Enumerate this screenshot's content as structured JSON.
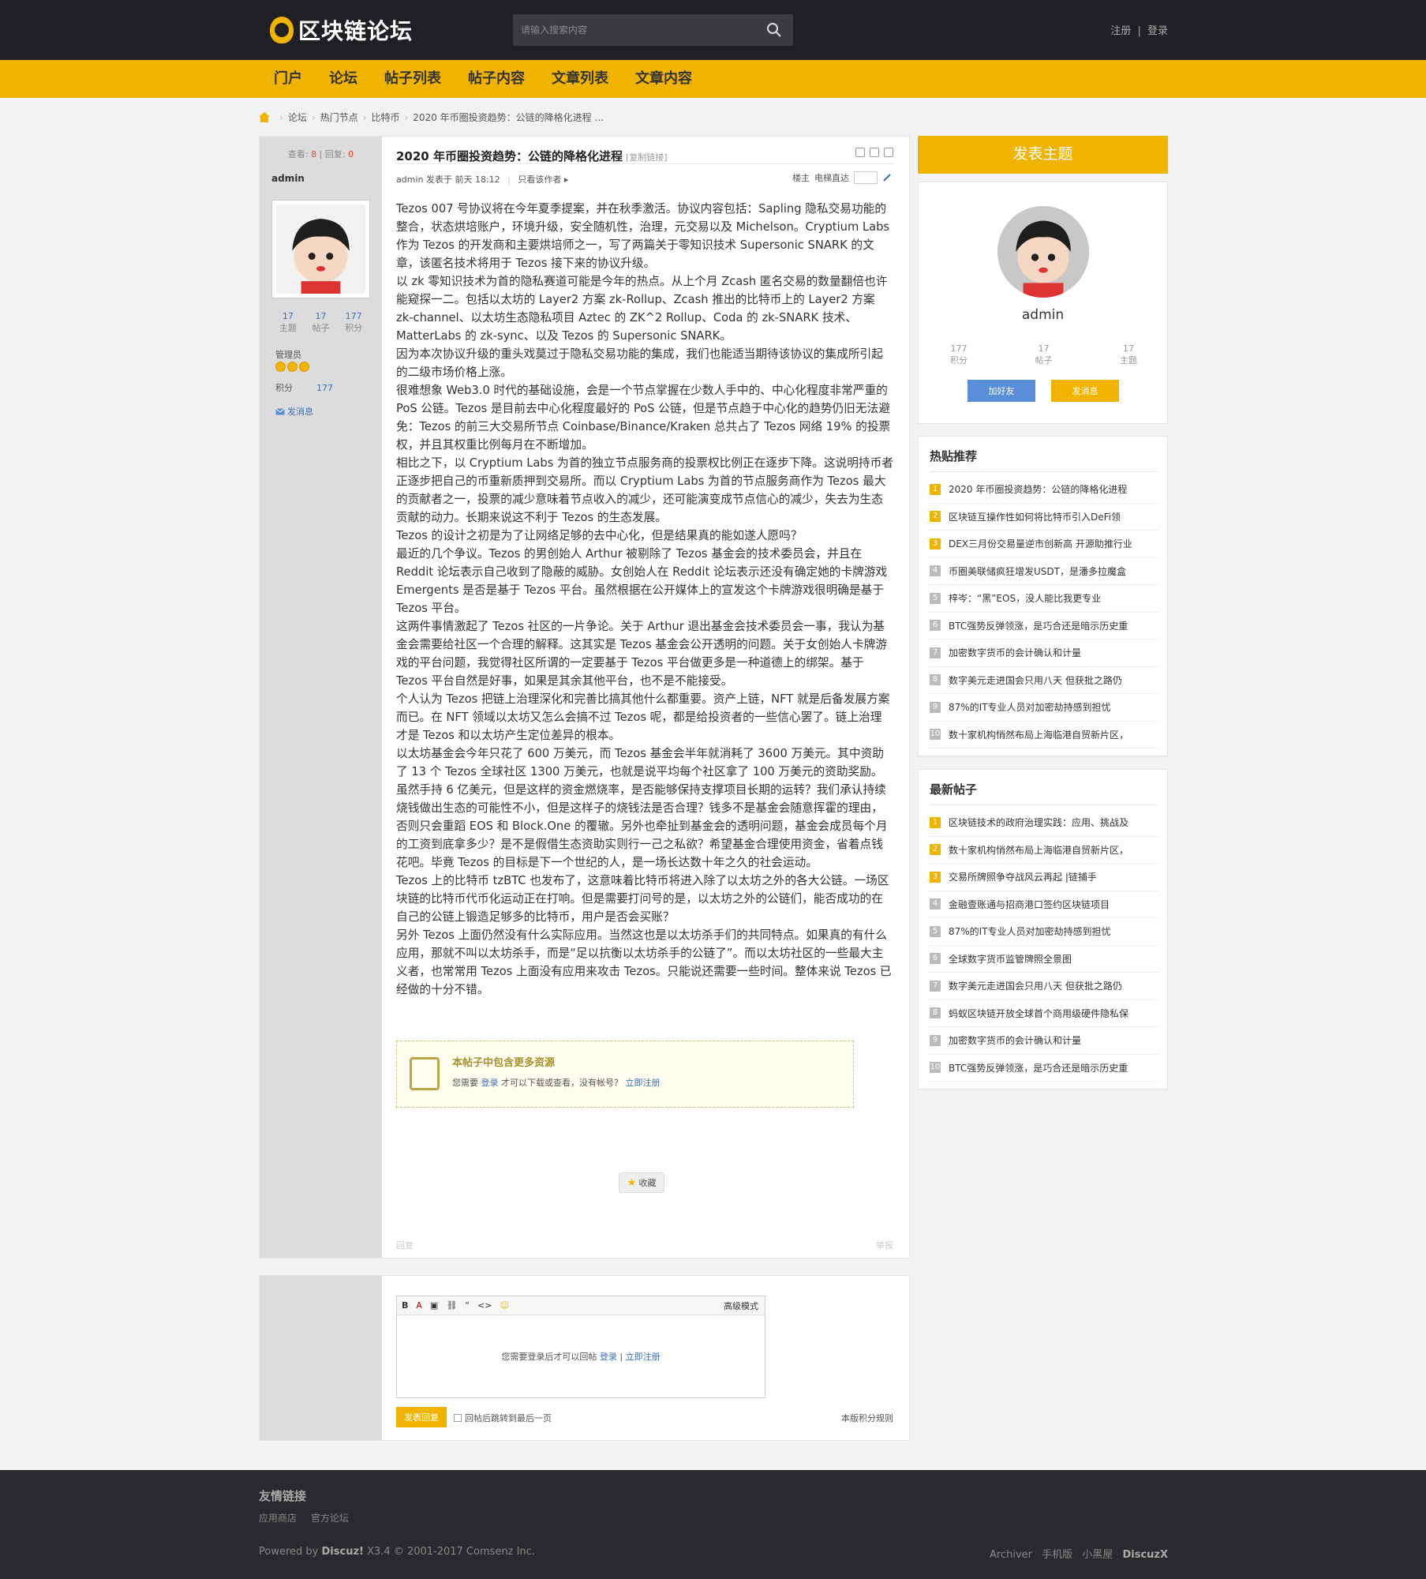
{
  "header": {
    "logo": "区块链论坛",
    "search_placeholder": "请输入搜索内容",
    "register": "注册",
    "login": "登录",
    "sep": "|"
  },
  "nav": [
    "门户",
    "论坛",
    "帖子列表",
    "帖子内容",
    "文章列表",
    "文章内容"
  ],
  "breadcrumb": [
    "论坛",
    "热门节点",
    "比特币",
    "2020 年币圈投资趋势：公链的降格化进程 ..."
  ],
  "post": {
    "views_label": "查看:",
    "views": "8",
    "replies_label": "回复:",
    "replies": "0",
    "author": "admin",
    "stats": [
      {
        "value": "17",
        "label": "主题"
      },
      {
        "value": "17",
        "label": "帖子"
      },
      {
        "value": "177",
        "label": "积分"
      }
    ],
    "group": "管理员",
    "points_label": "积分",
    "points": "177",
    "send_msg": "发消息",
    "title": "2020 年币圈投资趋势：公链的降格化进程",
    "copy_link": "[复制链接]",
    "meta_author": "admin",
    "meta_time": "发表于 前天 18:12",
    "meta_only_author": "只看该作者 ▸",
    "floor": "楼主",
    "jump_label": "电梯直达",
    "paragraphs": [
      "Tezos 007 号协议将在今年夏季提案，并在秋季激活。协议内容包括：Sapling 隐私交易功能的整合，状态烘培账户，环境升级，安全随机性，治理，元交易以及 Michelson。Cryptium Labs 作为 Tezos 的开发商和主要烘培师之一，写了两篇关于零知识技术 Supersonic SNARK 的文章，该匿名技术将用于 Tezos 接下来的协议升级。",
      "以 zk 零知识技术为首的隐私赛道可能是今年的热点。从上个月 Zcash 匿名交易的数量翻倍也许能窥探一二。包括以太坊的 Layer2 方案 zk-Rollup、Zcash 推出的比特币上的 Layer2 方案 zk-channel、以太坊生态隐私项目 Aztec 的 ZK^2 Rollup、Coda 的 zk-SNARK 技术、MatterLabs 的 zk-sync、以及 Tezos 的 Supersonic SNARK。",
      "因为本次协议升级的重头戏莫过于隐私交易功能的集成，我们也能适当期待该协议的集成所引起的二级市场价格上涨。",
      "很难想象 Web3.0 时代的基础设施，会是一个节点掌握在少数人手中的、中心化程度非常严重的 PoS 公链。Tezos 是目前去中心化程度最好的 PoS 公链，但是节点趋于中心化的趋势仍旧无法避免：Tezos 的前三大交易所节点 Coinbase/Binance/Kraken 总共占了 Tezos 网络 19% 的投票权，并且其权重比例每月在不断增加。",
      "相比之下，以 Cryptium Labs 为首的独立节点服务商的投票权比例正在逐步下降。这说明持币者正逐步把自己的币重新质押到交易所。而以 Cryptium Labs 为首的节点服务商作为 Tezos 最大的贡献者之一，投票的减少意味着节点收入的减少，还可能演变成节点信心的减少，失去为生态贡献的动力。长期来说这不利于 Tezos 的生态发展。",
      "Tezos 的设计之初是为了让网络足够的去中心化，但是结果真的能如遂人愿吗？",
      "最近的几个争议。Tezos 的男创始人 Arthur 被剔除了 Tezos 基金会的技术委员会，并且在 Reddit 论坛表示自己收到了隐蔽的威胁。女创始人在 Reddit 论坛表示还没有确定她的卡牌游戏 Emergents 是否是基于 Tezos 平台。虽然根据在公开媒体上的宣发这个卡牌游戏很明确是基于 Tezos 平台。",
      "这两件事情激起了 Tezos 社区的一片争论。关于 Arthur 退出基金会技术委员会一事，我认为基金会需要给社区一个合理的解释。这其实是 Tezos 基金会公开透明的问题。关于女创始人卡牌游戏的平台问题，我觉得社区所谓的一定要基于 Tezos 平台做更多是一种道德上的绑架。基于 Tezos 平台自然是好事，如果是其余其他平台，也不是不能接受。",
      "个人认为 Tezos 把链上治理深化和完善比搞其他什么都重要。资产上链，NFT 就是后备发展方案而已。在 NFT 领域以太坊又怎么会搞不过 Tezos 呢，都是给投资者的一些信心罢了。链上治理才是 Tezos 和以太坊产生定位差异的根本。",
      "以太坊基金会今年只花了 600 万美元，而 Tezos 基金会半年就消耗了 3600 万美元。其中资助了 13 个 Tezos 全球社区 1300 万美元，也就是说平均每个社区拿了 100 万美元的资助奖励。虽然手持 6 亿美元，但是这样的资金燃烧率，是否能够保持支撑项目长期的运转？我们承认持续烧钱做出生态的可能性不小，但是这样子的烧钱法是否合理？钱多不是基金会随意挥霍的理由，否则只会重蹈 EOS 和 Block.One 的覆辙。另外也牵扯到基金会的透明问题，基金会成员每个月的工资到底拿多少？是不是假借生态资助实则行一己之私欲？希望基金合理使用资金，省着点钱花吧。毕竟 Tezos 的目标是下一个世纪的人，是一场长达数十年之久的社会运动。",
      "Tezos 上的比特币 tzBTC 也发布了，这意味着比特币将进入除了以太坊之外的各大公链。一场区块链的比特币代币化运动正在打响。但是需要打问号的是，以太坊之外的公链们，能否成功的在自己的公链上锻造足够多的比特币，用户是否会买账？",
      "另外 Tezos 上面仍然没有什么实际应用。当然这也是以太坊杀手们的共同特点。如果真的有什么应用，那就不叫以太坊杀手，而是“足以抗衡以太坊杀手的公链了”。而以太坊社区的一些最大主义者，也常常用 Tezos 上面没有应用来攻击 Tezos。只能说还需要一些时间。整体来说 Tezos 已经做的十分不错。"
    ],
    "locked_title": "本帖子中包含更多资源",
    "locked_pre": "您需要",
    "locked_login": "登录",
    "locked_mid": "才可以下载或查看，没有帐号？",
    "locked_register": "立即注册",
    "favorite": "收藏",
    "foot_left": "回复",
    "foot_right": "举报"
  },
  "reply": {
    "toolbar": [
      "B",
      "A",
      "▣",
      "⛓",
      "“",
      "<>",
      "☺"
    ],
    "advanced": "高级模式",
    "hint_pre": "您需要登录后才可以回帖",
    "login": "登录",
    "sep": "|",
    "register": "立即注册",
    "submit": "发表回复",
    "checkbox_label": "回帖后跳转到最后一页",
    "rules": "本版积分规则"
  },
  "sidebar": {
    "new_thread": "发表主题",
    "user": {
      "name": "admin",
      "stats": [
        {
          "value": "177",
          "label": "积分"
        },
        {
          "value": "17",
          "label": "帖子"
        },
        {
          "value": "17",
          "label": "主题"
        }
      ],
      "add_friend": "加好友",
      "send_msg": "发消息"
    },
    "hot_title": "热贴推荐",
    "hot": [
      "2020 年币圈投资趋势：公链的降格化进程",
      "区块链互操作性如何将比特币引入DeFi领",
      "DEX三月份交易量逆市创新高 开源助推行业",
      "币圈美联储疯狂增发USDT，是潘多拉魔盒",
      "梓岑：“黑”EOS，没人能比我更专业",
      "BTC强势反弹领涨，是巧合还是暗示历史重",
      "加密数字货币的会计确认和计量",
      "数字美元走进国会只用八天 但获批之路仍",
      "87%的IT专业人员对加密劫持感到担忧",
      "数十家机构悄然布局上海临港自贸新片区，"
    ],
    "new_title": "最新帖子",
    "new": [
      "区块链技术的政府治理实践：应用、挑战及",
      "数十家机构悄然布局上海临港自贸新片区，",
      "交易所牌照争夺战风云再起 |链捕手",
      "金融壹账通与招商港口签约区块链项目",
      "87%的IT专业人员对加密劫持感到担忧",
      "全球数字货币监管牌照全景图",
      "数字美元走进国会只用八天 但获批之路仍",
      "蚂蚁区块链开放全球首个商用级硬件隐私保",
      "加密数字货币的会计确认和计量",
      "BTC强势反弹领涨，是巧合还是暗示历史重"
    ]
  },
  "footer": {
    "links_title": "友情链接",
    "links": [
      "应用商店",
      "官方论坛"
    ],
    "powered_pre": "Powered by",
    "powered_brand": "Discuz!",
    "powered_post": "X3.4 © 2001-2017 Comsenz Inc.",
    "right_links": [
      "Archiver",
      "手机版",
      "小黑屋"
    ],
    "right_brand": "DiscuzX"
  },
  "colors": {
    "accent": "#f0b400",
    "dark": "#1f1f24",
    "link": "#3b6fb6"
  }
}
